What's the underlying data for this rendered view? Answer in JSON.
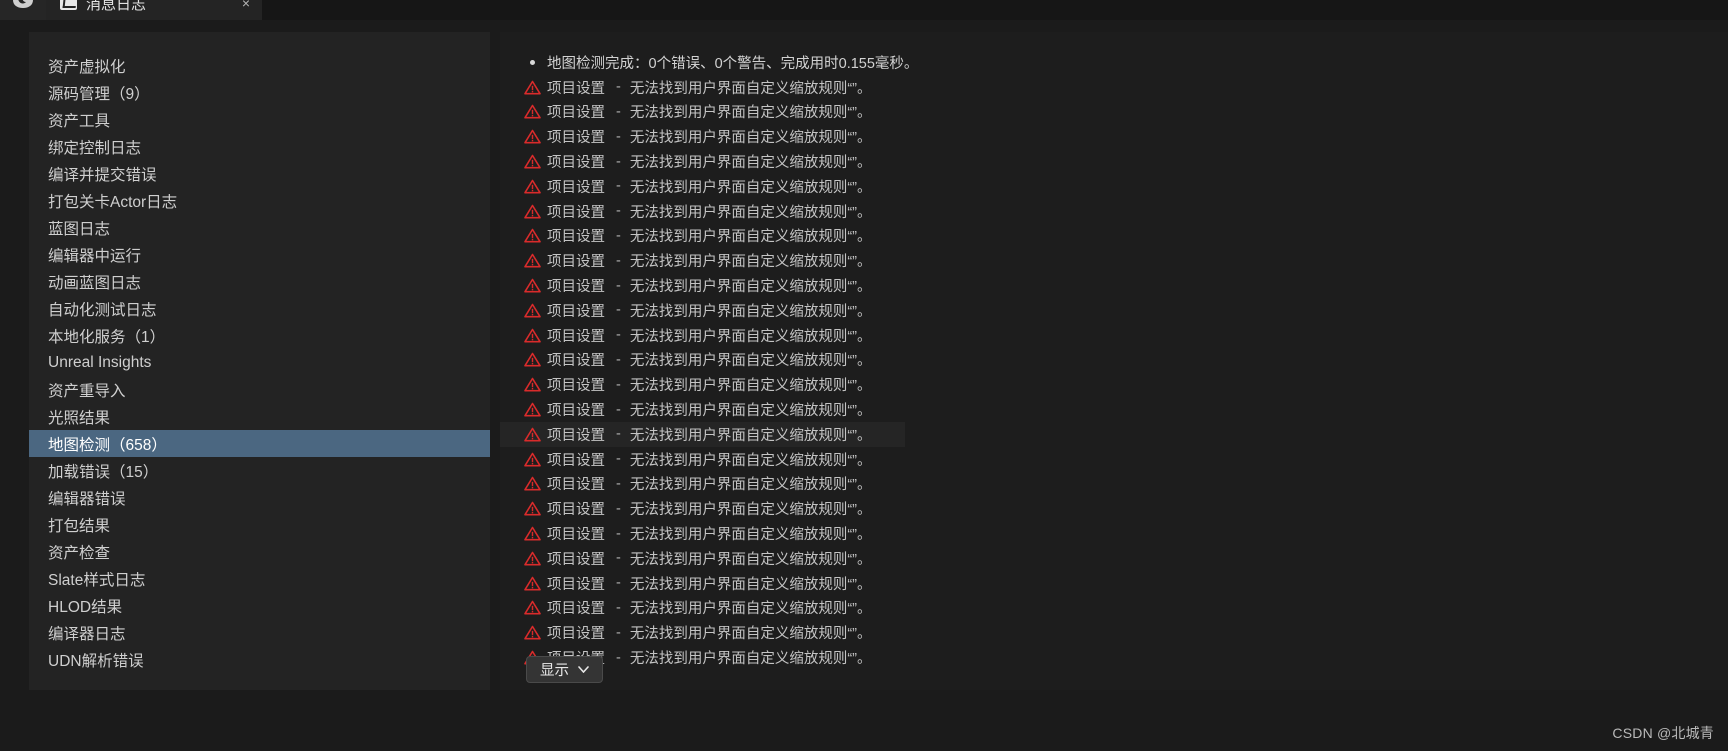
{
  "window": {
    "tab": {
      "label": "消息日志",
      "icon": "message-log-icon",
      "close_label": "×"
    },
    "app_logo_glyph": "🐺"
  },
  "colors": {
    "selection": "#4b6781",
    "warning_icon": "#d92b2b",
    "panel_bg": "#232323",
    "message_bg": "#1d1d1d",
    "hover_row": "#252525"
  },
  "sidebar": {
    "items": [
      {
        "label": "资产虚拟化",
        "selected": false
      },
      {
        "label": "源码管理（9）",
        "selected": false
      },
      {
        "label": "资产工具",
        "selected": false
      },
      {
        "label": "绑定控制日志",
        "selected": false
      },
      {
        "label": "编译并提交错误",
        "selected": false
      },
      {
        "label": "打包关卡Actor日志",
        "selected": false
      },
      {
        "label": "蓝图日志",
        "selected": false
      },
      {
        "label": "编辑器中运行",
        "selected": false
      },
      {
        "label": "动画蓝图日志",
        "selected": false
      },
      {
        "label": "自动化测试日志",
        "selected": false
      },
      {
        "label": "本地化服务（1）",
        "selected": false
      },
      {
        "label": "Unreal Insights",
        "selected": false
      },
      {
        "label": "资产重导入",
        "selected": false
      },
      {
        "label": "光照结果",
        "selected": false
      },
      {
        "label": "地图检测（658）",
        "selected": true
      },
      {
        "label": "加载错误（15）",
        "selected": false
      },
      {
        "label": "编辑器错误",
        "selected": false
      },
      {
        "label": "打包结果",
        "selected": false
      },
      {
        "label": "资产检查",
        "selected": false
      },
      {
        "label": "Slate样式日志",
        "selected": false
      },
      {
        "label": "HLOD结果",
        "selected": false
      },
      {
        "label": "编译器日志",
        "selected": false
      },
      {
        "label": "UDN解析错误",
        "selected": false
      }
    ]
  },
  "messages": {
    "rows": [
      {
        "type": "info",
        "marker": "bullet-point",
        "text": "地图检测完成：0个错误、0个警告、完成用时0.155毫秒。",
        "hovered": false
      },
      {
        "type": "warning",
        "marker": "warning-triangle-icon",
        "category": "项目设置",
        "separator": "-",
        "text": "无法找到用户界面自定义缩放规则“”。",
        "hovered": false
      },
      {
        "type": "warning",
        "marker": "warning-triangle-icon",
        "category": "项目设置",
        "separator": "-",
        "text": "无法找到用户界面自定义缩放规则“”。",
        "hovered": false
      },
      {
        "type": "warning",
        "marker": "warning-triangle-icon",
        "category": "项目设置",
        "separator": "-",
        "text": "无法找到用户界面自定义缩放规则“”。",
        "hovered": false
      },
      {
        "type": "warning",
        "marker": "warning-triangle-icon",
        "category": "项目设置",
        "separator": "-",
        "text": "无法找到用户界面自定义缩放规则“”。",
        "hovered": false
      },
      {
        "type": "warning",
        "marker": "warning-triangle-icon",
        "category": "项目设置",
        "separator": "-",
        "text": "无法找到用户界面自定义缩放规则“”。",
        "hovered": false
      },
      {
        "type": "warning",
        "marker": "warning-triangle-icon",
        "category": "项目设置",
        "separator": "-",
        "text": "无法找到用户界面自定义缩放规则“”。",
        "hovered": false
      },
      {
        "type": "warning",
        "marker": "warning-triangle-icon",
        "category": "项目设置",
        "separator": "-",
        "text": "无法找到用户界面自定义缩放规则“”。",
        "hovered": false
      },
      {
        "type": "warning",
        "marker": "warning-triangle-icon",
        "category": "项目设置",
        "separator": "-",
        "text": "无法找到用户界面自定义缩放规则“”。",
        "hovered": false
      },
      {
        "type": "warning",
        "marker": "warning-triangle-icon",
        "category": "项目设置",
        "separator": "-",
        "text": "无法找到用户界面自定义缩放规则“”。",
        "hovered": false
      },
      {
        "type": "warning",
        "marker": "warning-triangle-icon",
        "category": "项目设置",
        "separator": "-",
        "text": "无法找到用户界面自定义缩放规则“”。",
        "hovered": false
      },
      {
        "type": "warning",
        "marker": "warning-triangle-icon",
        "category": "项目设置",
        "separator": "-",
        "text": "无法找到用户界面自定义缩放规则“”。",
        "hovered": false
      },
      {
        "type": "warning",
        "marker": "warning-triangle-icon",
        "category": "项目设置",
        "separator": "-",
        "text": "无法找到用户界面自定义缩放规则“”。",
        "hovered": false
      },
      {
        "type": "warning",
        "marker": "warning-triangle-icon",
        "category": "项目设置",
        "separator": "-",
        "text": "无法找到用户界面自定义缩放规则“”。",
        "hovered": false
      },
      {
        "type": "warning",
        "marker": "warning-triangle-icon",
        "category": "项目设置",
        "separator": "-",
        "text": "无法找到用户界面自定义缩放规则“”。",
        "hovered": false
      },
      {
        "type": "warning",
        "marker": "warning-triangle-icon",
        "category": "项目设置",
        "separator": "-",
        "text": "无法找到用户界面自定义缩放规则“”。",
        "hovered": true
      },
      {
        "type": "warning",
        "marker": "warning-triangle-icon",
        "category": "项目设置",
        "separator": "-",
        "text": "无法找到用户界面自定义缩放规则“”。",
        "hovered": false
      },
      {
        "type": "warning",
        "marker": "warning-triangle-icon",
        "category": "项目设置",
        "separator": "-",
        "text": "无法找到用户界面自定义缩放规则“”。",
        "hovered": false
      },
      {
        "type": "warning",
        "marker": "warning-triangle-icon",
        "category": "项目设置",
        "separator": "-",
        "text": "无法找到用户界面自定义缩放规则“”。",
        "hovered": false
      },
      {
        "type": "warning",
        "marker": "warning-triangle-icon",
        "category": "项目设置",
        "separator": "-",
        "text": "无法找到用户界面自定义缩放规则“”。",
        "hovered": false
      },
      {
        "type": "warning",
        "marker": "warning-triangle-icon",
        "category": "项目设置",
        "separator": "-",
        "text": "无法找到用户界面自定义缩放规则“”。",
        "hovered": false
      },
      {
        "type": "warning",
        "marker": "warning-triangle-icon",
        "category": "项目设置",
        "separator": "-",
        "text": "无法找到用户界面自定义缩放规则“”。",
        "hovered": false
      },
      {
        "type": "warning",
        "marker": "warning-triangle-icon",
        "category": "项目设置",
        "separator": "-",
        "text": "无法找到用户界面自定义缩放规则“”。",
        "hovered": false
      },
      {
        "type": "warning",
        "marker": "warning-triangle-icon",
        "category": "项目设置",
        "separator": "-",
        "text": "无法找到用户界面自定义缩放规则“”。",
        "hovered": false
      },
      {
        "type": "warning",
        "marker": "warning-triangle-icon",
        "category": "项目设置",
        "separator": "-",
        "text": "无法找到用户界面自定义缩放规则“”。",
        "hovered": false
      }
    ]
  },
  "toolbar": {
    "show_filter_label": "显示",
    "show_filter_icon": "chevron-down-icon"
  },
  "watermark": {
    "text": "CSDN @北城青"
  }
}
